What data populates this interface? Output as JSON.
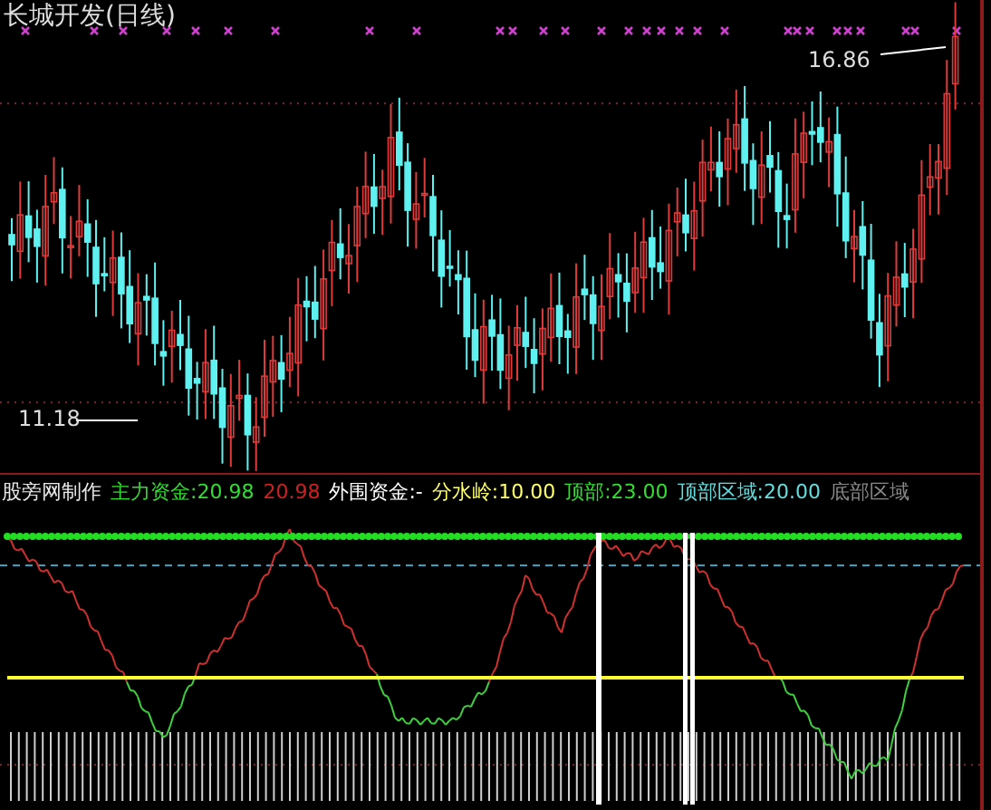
{
  "window": {
    "title": "长城开发(日线)"
  },
  "price_chart": {
    "high_label": "16.86",
    "low_label": "11.18"
  },
  "indicator": {
    "legend": [
      {
        "text": "股旁网制作",
        "color": "#e8e8e8"
      },
      {
        "text": "主力资金:20.98",
        "color": "#33dd33"
      },
      {
        "text": "20.98",
        "color": "#cc2222"
      },
      {
        "text": "外围资金:-",
        "color": "#ffffff"
      },
      {
        "text": "分水岭:10.00",
        "color": "#ffff66"
      },
      {
        "text": "顶部:23.00",
        "color": "#33dd33"
      },
      {
        "text": "顶部区域:20.00",
        "color": "#66dddd"
      },
      {
        "text": "底部区域",
        "color": "#888888"
      }
    ]
  }
}
